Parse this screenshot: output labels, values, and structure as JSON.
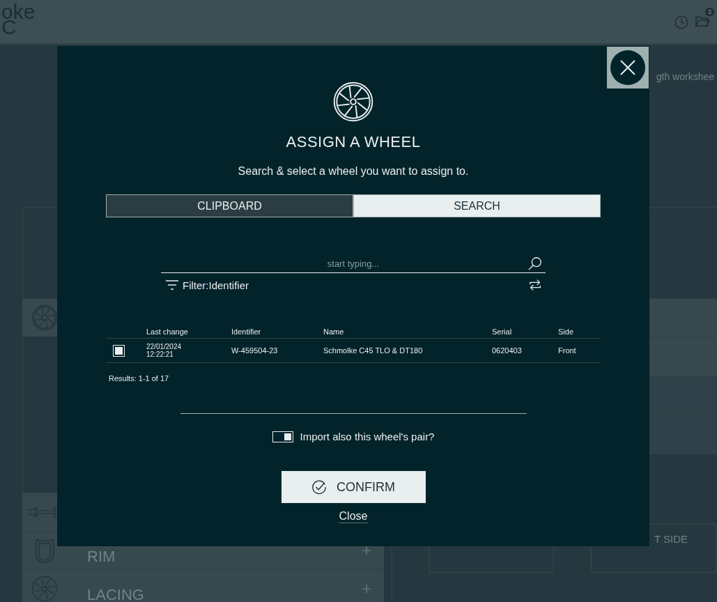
{
  "header": {
    "logo_lines": [
      "oke",
      "C"
    ],
    "notification_count": "3"
  },
  "page": {
    "worksheet_text": "gth workshee",
    "left_sections": [
      {
        "kind": "hub"
      },
      {
        "kind": "rim",
        "label": "RIM"
      },
      {
        "kind": "lacing",
        "label": "LACING"
      }
    ],
    "side_box_label": "T SIDE"
  },
  "modal": {
    "title": "ASSIGN A WHEEL",
    "subtitle": "Search & select a wheel you want to assign to.",
    "tabs": [
      {
        "label": "CLIPBOARD",
        "selected": false
      },
      {
        "label": "SEARCH",
        "selected": true
      }
    ],
    "search": {
      "placeholder": "start typing..."
    },
    "filter": {
      "label": "Filter:Identifier"
    },
    "table": {
      "columns": [
        "Last change",
        "Identifier",
        "Name",
        "Serial",
        "Side"
      ],
      "rows": [
        {
          "selected": true,
          "last_change": [
            "22/01/2024",
            "12:22:21"
          ],
          "identifier": "W-459504-23",
          "name": "Schmolke C45 TLO & DT180",
          "serial": "0620403",
          "side": "Front"
        }
      ]
    },
    "results": "Results: 1-1 of 17",
    "pair_toggle": {
      "label": "Import also this wheel's pair?",
      "on": true
    },
    "confirm": "CONFIRM",
    "close": "Close"
  }
}
